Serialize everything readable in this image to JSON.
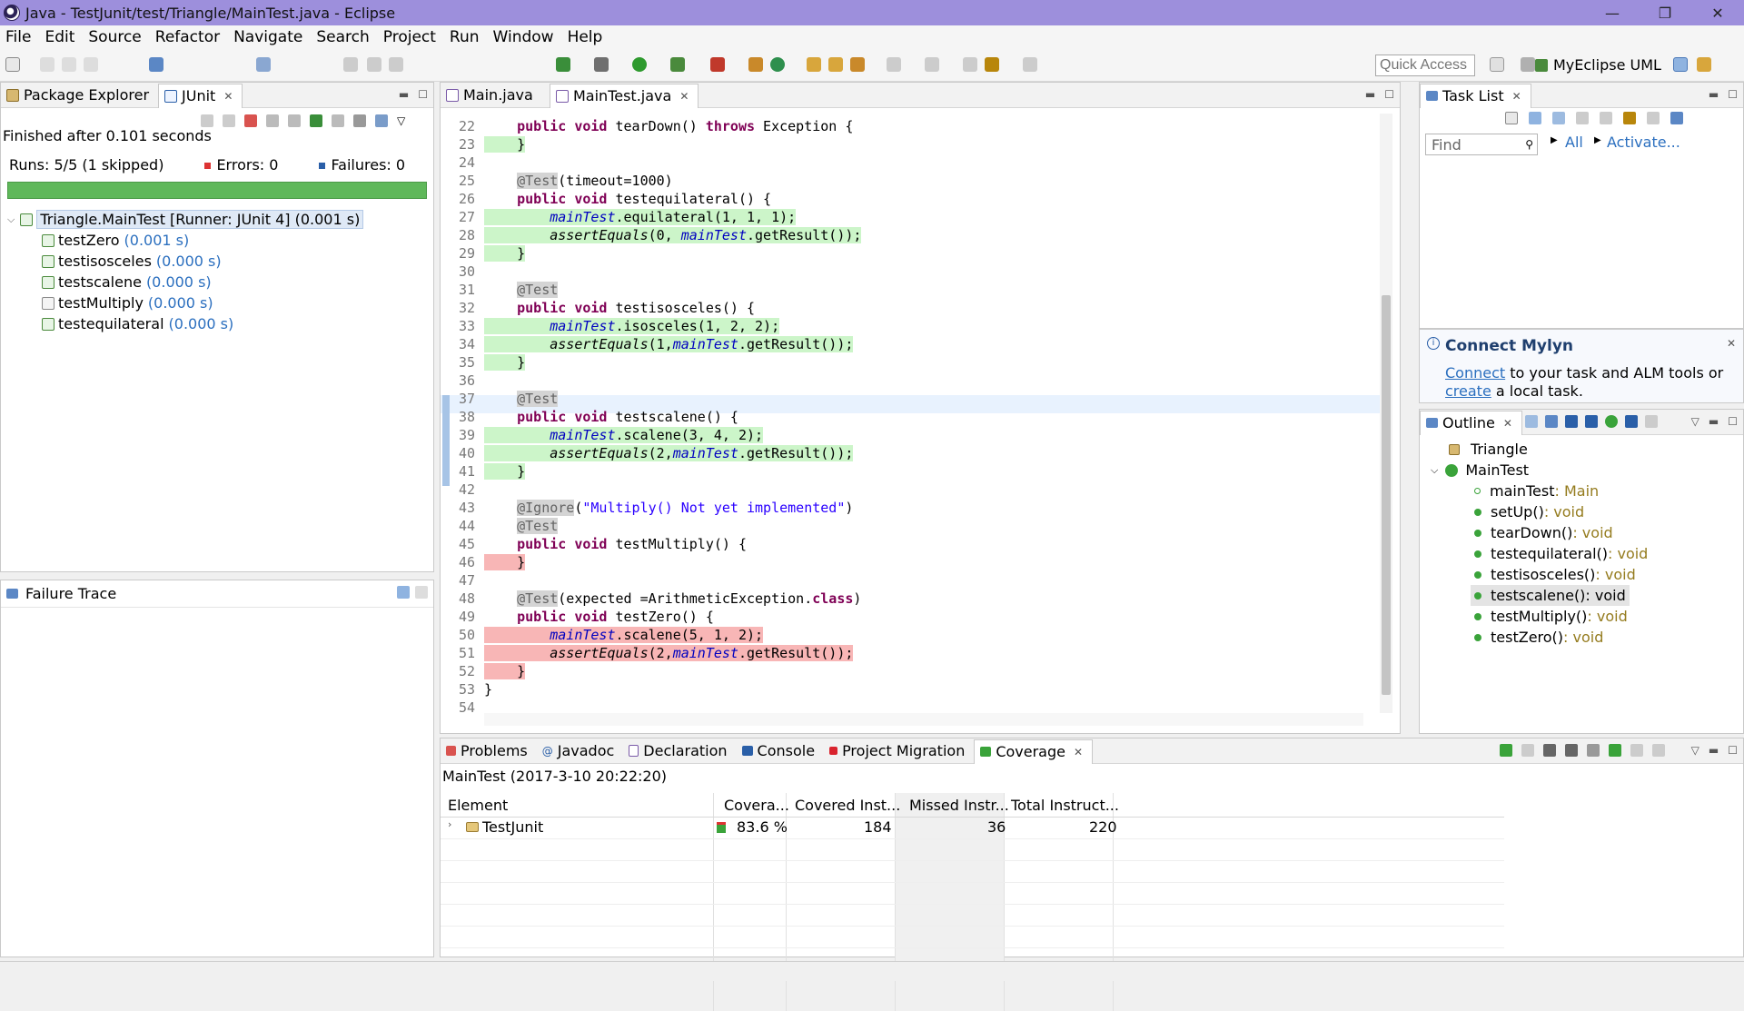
{
  "window": {
    "title": "Java - TestJunit/test/Triangle/MainTest.java - Eclipse",
    "controls": [
      "—",
      "❐",
      "✕"
    ]
  },
  "menu": [
    "File",
    "Edit",
    "Source",
    "Refactor",
    "Navigate",
    "Search",
    "Project",
    "Run",
    "Window",
    "Help"
  ],
  "toolbar": {
    "quick_access_placeholder": "Quick Access",
    "perspective_label": "MyEclipse UML"
  },
  "left_panel": {
    "tabs": [
      {
        "label": "Package Explorer",
        "icon": "package-icon"
      },
      {
        "label": "JUnit",
        "icon": "junit-icon",
        "active": true
      }
    ],
    "status": "Finished after 0.101 seconds",
    "runs": "Runs:  5/5 (1 skipped)",
    "errors": "Errors:  0",
    "failures": "Failures:  0",
    "progress_fraction": 1.0,
    "tree": {
      "root_label": "Triangle.MainTest [Runner: JUnit 4] (0.001 s)",
      "tests": [
        {
          "name": "testZero",
          "time": "(0.001 s)",
          "skipped": false
        },
        {
          "name": "testisosceles",
          "time": "(0.000 s)",
          "skipped": false
        },
        {
          "name": "testscalene",
          "time": "(0.000 s)",
          "skipped": false
        },
        {
          "name": "testMultiply",
          "time": "(0.000 s)",
          "skipped": true
        },
        {
          "name": "testequilateral",
          "time": "(0.000 s)",
          "skipped": false
        }
      ]
    },
    "failure_trace_label": "Failure Trace"
  },
  "editor": {
    "tabs": [
      {
        "label": "Main.java",
        "active": false
      },
      {
        "label": "MainTest.java",
        "active": true
      }
    ],
    "lines": [
      {
        "n": "22",
        "text": "    public void tearDown() throws Exception {"
      },
      {
        "n": "23",
        "text": "    }"
      },
      {
        "n": "24",
        "text": ""
      },
      {
        "n": "25",
        "text": "    @Test(timeout=1000)"
      },
      {
        "n": "26",
        "text": "    public void testequilateral() {"
      },
      {
        "n": "27",
        "text": "        mainTest.equilateral(1, 1, 1);"
      },
      {
        "n": "28",
        "text": "        assertEquals(0, mainTest.getResult());"
      },
      {
        "n": "29",
        "text": "    }"
      },
      {
        "n": "30",
        "text": ""
      },
      {
        "n": "31",
        "text": "    @Test"
      },
      {
        "n": "32",
        "text": "    public void testisosceles() {"
      },
      {
        "n": "33",
        "text": "        mainTest.isosceles(1, 2, 2);"
      },
      {
        "n": "34",
        "text": "        assertEquals(1,mainTest.getResult());"
      },
      {
        "n": "35",
        "text": "    }"
      },
      {
        "n": "36",
        "text": ""
      },
      {
        "n": "37",
        "text": "    @Test"
      },
      {
        "n": "38",
        "text": "    public void testscalene() {"
      },
      {
        "n": "39",
        "text": "        mainTest.scalene(3, 4, 2);"
      },
      {
        "n": "40",
        "text": "        assertEquals(2,mainTest.getResult());"
      },
      {
        "n": "41",
        "text": "    }"
      },
      {
        "n": "42",
        "text": ""
      },
      {
        "n": "43",
        "text": "    @Ignore(\"Multiply() Not yet implemented\")"
      },
      {
        "n": "44",
        "text": "    @Test"
      },
      {
        "n": "45",
        "text": "    public void testMultiply() {"
      },
      {
        "n": "46",
        "text": "    }"
      },
      {
        "n": "47",
        "text": ""
      },
      {
        "n": "48",
        "text": "    @Test(expected =ArithmeticException.class)"
      },
      {
        "n": "49",
        "text": "    public void testZero() {"
      },
      {
        "n": "50",
        "text": "        mainTest.scalene(5, 1, 2);"
      },
      {
        "n": "51",
        "text": "        assertEquals(2,mainTest.getResult());"
      },
      {
        "n": "52",
        "text": "    }"
      },
      {
        "n": "53",
        "text": "}"
      },
      {
        "n": "54",
        "text": ""
      }
    ]
  },
  "task_list": {
    "tab_label": "Task List",
    "find_placeholder": "Find",
    "all_label": "All",
    "activate_label": "Activate..."
  },
  "mylyn": {
    "title": "Connect Mylyn",
    "connect_link": "Connect",
    "line1_rest": " to your task and ALM tools or",
    "create_link": "create",
    "line2_rest": " a local task."
  },
  "outline": {
    "tab_label": "Outline",
    "items": [
      {
        "name": "Triangle",
        "type": ""
      },
      {
        "name": "MainTest",
        "type": ""
      },
      {
        "name": "mainTest",
        "type": " : Main"
      },
      {
        "name": "setUp()",
        "type": " : void"
      },
      {
        "name": "tearDown()",
        "type": " : void"
      },
      {
        "name": "testequilateral()",
        "type": " : void"
      },
      {
        "name": "testisosceles()",
        "type": " : void"
      },
      {
        "name": "testscalene()",
        "type": " : void"
      },
      {
        "name": "testMultiply()",
        "type": " : void"
      },
      {
        "name": "testZero()",
        "type": " : void"
      }
    ]
  },
  "bottom_panel": {
    "tabs": [
      "Problems",
      "Javadoc",
      "Declaration",
      "Console",
      "Project Migration",
      "Coverage"
    ],
    "session": "MainTest (2017-3-10 20:22:20)",
    "columns": [
      "Element",
      "Covera...",
      "Covered Inst...",
      "Missed Instr...",
      "Total Instruct..."
    ],
    "row": {
      "element": "TestJunit",
      "coverage": "83.6 %",
      "covered": "184",
      "missed": "36",
      "total": "220"
    },
    "colors": {
      "covered": "#3aa33a",
      "missed": "#d33"
    }
  }
}
